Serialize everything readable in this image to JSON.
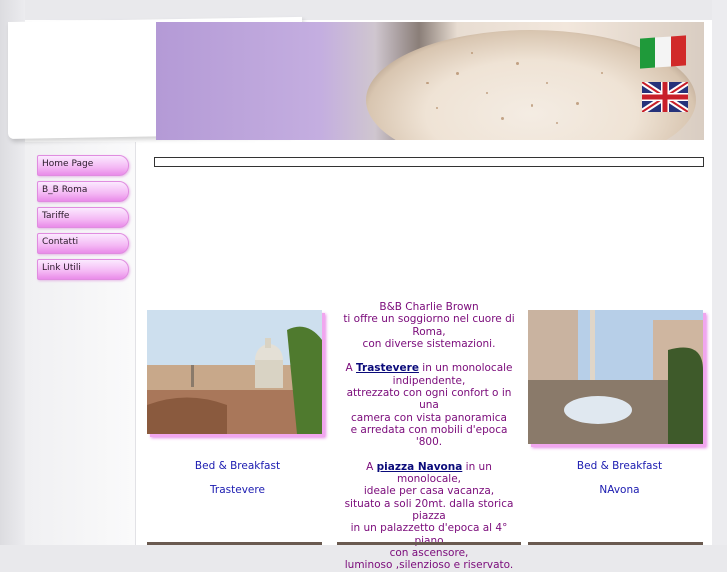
{
  "nav": {
    "items": [
      {
        "label": "Home Page"
      },
      {
        "label": "B_B Roma"
      },
      {
        "label": "Tariffe"
      },
      {
        "label": "Contatti"
      },
      {
        "label": "Link Utili"
      }
    ]
  },
  "languages": {
    "italian_icon": "italy-flag-icon",
    "english_icon": "uk-flag-icon"
  },
  "intro": {
    "line1": "B&B Charlie Brown",
    "line2": "ti offre un soggiorno nel cuore di",
    "line3": "Roma,",
    "line4": "con diverse sistemazioni.",
    "trastevere_prefix": "A ",
    "trastevere_link": "Trastevere",
    "trastevere_suffix": " in un monolocale",
    "t1": "indipendente,",
    "t2": "attrezzato con ogni confort o in una",
    "t3": "camera con vista panoramica",
    "t4": "e arredata con mobili d'epoca '800.",
    "navona_prefix": "A ",
    "navona_link": "piazza Navona",
    "navona_suffix": " in un monolocale,",
    "n1": "ideale per casa vacanza,",
    "n2": "situato a soli 20mt. dalla storica",
    "n3": "piazza",
    "n4": "in un palazzetto d'epoca al 4° piano",
    "n5": "con ascensore,",
    "n6": "luminoso ,silenzioso e riservato."
  },
  "left_card": {
    "title": "Bed & Breakfast",
    "subtitle": "Trastevere"
  },
  "right_card": {
    "title": "Bed & Breakfast",
    "subtitle": "NAvona"
  },
  "colors": {
    "accent_pink": "#f4b8f4",
    "text_purple": "#7a0a7a",
    "caption_blue": "#1a1ab0"
  }
}
